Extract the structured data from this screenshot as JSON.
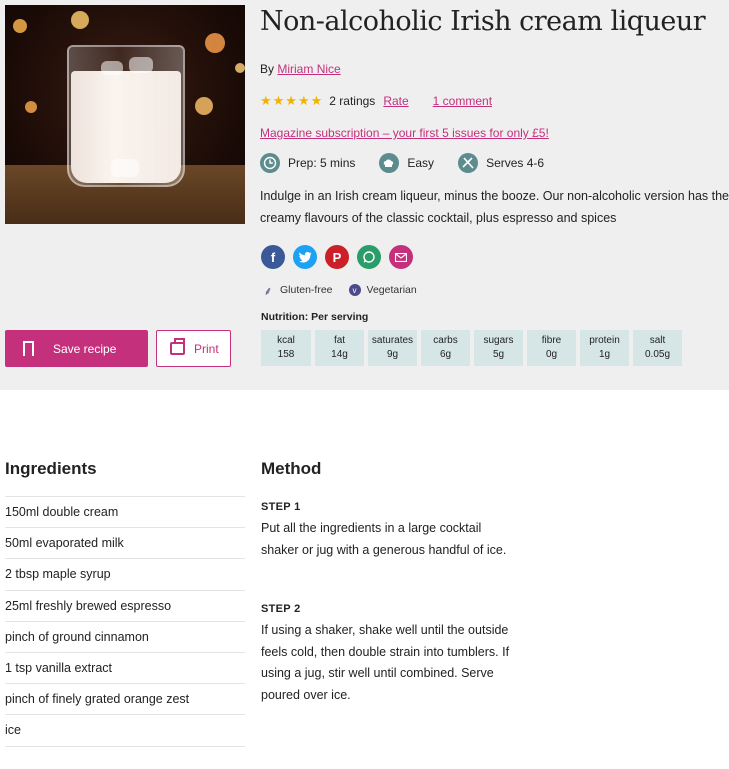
{
  "recipe": {
    "title": "Non-alcoholic Irish cream liqueur",
    "byline_prefix": "By",
    "author": "Miriam Nice",
    "rating_count": "2 ratings",
    "rate_label": "Rate",
    "comments_label": "1 comment",
    "stars": 5,
    "promo": "Magazine subscription – your first 5 issues for only £5!",
    "prep_label": "Prep:",
    "prep_value": "5 mins",
    "difficulty": "Easy",
    "serves": "Serves 4-6",
    "description": "Indulge in an Irish cream liqueur, minus the booze. Our non-alcoholic version has the creamy flavours of the classic cocktail, plus espresso and spices"
  },
  "share": [
    "facebook-icon",
    "twitter-icon",
    "pinterest-icon",
    "whatsapp-icon",
    "email-icon"
  ],
  "diets": [
    "Gluten-free",
    "Vegetarian"
  ],
  "nutrition": {
    "title": "Nutrition: Per serving",
    "items": [
      {
        "label": "kcal",
        "value": "158"
      },
      {
        "label": "fat",
        "value": "14g"
      },
      {
        "label": "saturates",
        "value": "9g"
      },
      {
        "label": "carbs",
        "value": "6g"
      },
      {
        "label": "sugars",
        "value": "5g"
      },
      {
        "label": "fibre",
        "value": "0g"
      },
      {
        "label": "protein",
        "value": "1g"
      },
      {
        "label": "salt",
        "value": "0.05g"
      }
    ]
  },
  "actions": {
    "save_label": "Save recipe",
    "print_label": "Print"
  },
  "ingredients": {
    "heading": "Ingredients",
    "items": [
      "150ml double cream",
      "50ml evaporated milk",
      "2 tbsp maple syrup",
      "25ml freshly brewed espresso",
      "pinch of ground cinnamon",
      "1 tsp vanilla extract",
      "pinch of finely grated orange zest",
      "ice"
    ]
  },
  "method": {
    "heading": "Method",
    "steps": [
      {
        "title": "STEP 1",
        "text": "Put all the ingredients in a large cocktail shaker or jug with a generous handful of ice."
      },
      {
        "title": "STEP 2",
        "text": "If using a shaker, shake well until the outside feels cold, then double strain into tumblers. If using a jug, stir well until combined. Serve poured over ice."
      }
    ]
  },
  "colors": {
    "accent": "#c5307d",
    "hero_bg": "#efefef",
    "nutrition_bg": "#d6e6e7",
    "meta_icon": "#5d8c8f",
    "star": "#f0b400"
  }
}
